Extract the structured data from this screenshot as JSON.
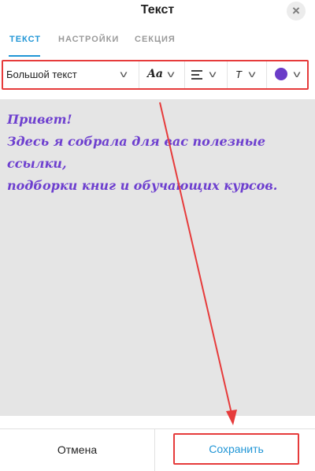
{
  "header": {
    "title": "Текст",
    "close_icon": "close-icon"
  },
  "tabs": [
    {
      "label": "ТЕКСТ",
      "active": true
    },
    {
      "label": "НАСТРОЙКИ",
      "active": false
    },
    {
      "label": "СЕКЦИЯ",
      "active": false
    }
  ],
  "toolbar": {
    "text_style": "Большой текст",
    "font_label": "Aa",
    "align_icon": "align-left-icon",
    "size_label": "T",
    "color": "#6a3cc8"
  },
  "editor": {
    "line1": "Привет!",
    "line2": "Здесь я собрала для вас полезные ссылки,",
    "line3": "подборки книг и обучающих курсов."
  },
  "footer": {
    "cancel": "Отмена",
    "save": "Сохранить"
  },
  "colors": {
    "accent": "#2196d6",
    "highlight": "#e63b3b",
    "text_purple": "#6d3fcf"
  }
}
